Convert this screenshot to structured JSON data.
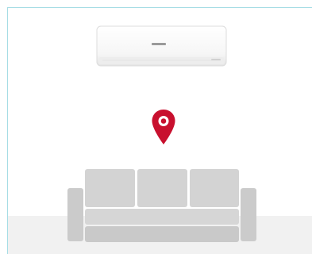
{
  "scene": {
    "air_conditioner": {
      "icon": "air-conditioner-icon",
      "brand_text": ""
    },
    "location_pin": {
      "icon": "map-pin-icon",
      "color": "#c8102e"
    },
    "sofa": {
      "icon": "sofa-icon",
      "color": "#cfcfcf"
    },
    "colors": {
      "frame_border": "#a6dde5",
      "floor": "#f1f1f1",
      "background": "#ffffff"
    }
  }
}
